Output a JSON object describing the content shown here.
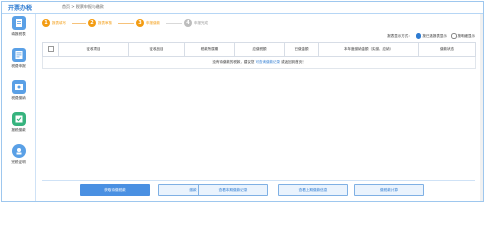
{
  "header": {
    "app_title": "开票办税",
    "breadcrumb": "首页 > 税票申报与缴款"
  },
  "sidebar": {
    "items": [
      {
        "label": "填报税表",
        "icon": "document-icon"
      },
      {
        "label": "税费申报",
        "icon": "list-icon"
      },
      {
        "label": "税费缴纳",
        "icon": "tax-icon"
      },
      {
        "label": "报税缴款",
        "icon": "pay-icon"
      },
      {
        "label": "完税证明",
        "icon": "cert-icon"
      }
    ]
  },
  "steps": [
    {
      "num": "1",
      "label": "报表填写"
    },
    {
      "num": "2",
      "label": "报表审核"
    },
    {
      "num": "3",
      "label": "申报缴款"
    },
    {
      "num": "4",
      "label": "申报完成"
    }
  ],
  "table_hint": {
    "prefix": "报表显示方式：",
    "option1": "按已选报表显示",
    "option2": "按明细显示"
  },
  "table": {
    "columns": [
      "",
      "征收项目",
      "征收品目",
      "税款所属期",
      "应缴税额",
      "已缴金额",
      "本年度缴纳金额（实缴、应纳）",
      "缴款状态"
    ],
    "empty_prefix": "没有待缴款的税款，建议您",
    "empty_link": "可查询缴款记录",
    "empty_suffix": "或返回到首页！"
  },
  "buttons": {
    "primary": "获取待缴税款",
    "b2": "缴款",
    "b3": "查看本期缴款记录",
    "b4": "查看上期缴款信息",
    "b5": "缴税款计算"
  },
  "colors": {
    "accent": "#2e7bd1",
    "step": "#f39c12",
    "button_primary": "#4a90e2"
  }
}
